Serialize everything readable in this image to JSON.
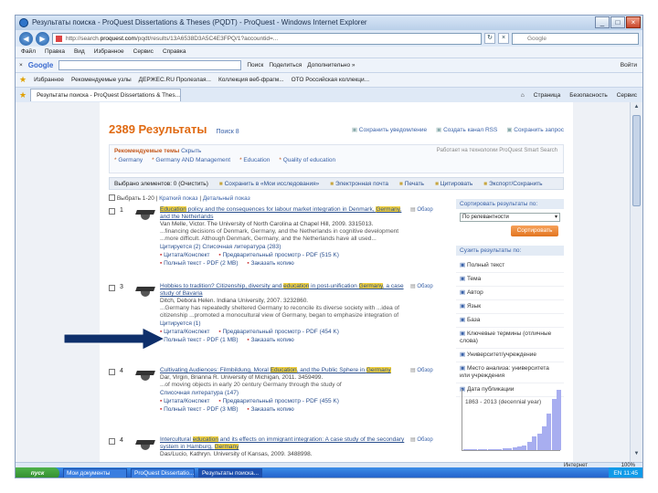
{
  "window": {
    "title": "Результаты поиска - ProQuest Dissertations & Theses (PQDT) - ProQuest - Windows Internet Explorer",
    "buttons": [
      "_",
      "□",
      "×"
    ]
  },
  "address_bar": {
    "url_prefix": "http://search.",
    "url_domain": "proquest.com",
    "url_rest": "/pqdt/results/13A6538D3A5C4E3FPQ/1?accountid=...",
    "search_placeholder": "Google"
  },
  "menu": [
    "Файл",
    "Правка",
    "Вид",
    "Избранное",
    "Сервис",
    "Справка"
  ],
  "google_bar": {
    "logo": "Google",
    "items": [
      "Поиск",
      "Поделиться",
      "Дополнительно »"
    ],
    "right": "Войти"
  },
  "favorites_bar": {
    "label": "Избранное",
    "items": [
      "Рекомендуемые узлы",
      "ДЕРЖЕС.RU Пролезлая...",
      "Коллекция веб-фрагм...",
      "ОТО Российская коллекци..."
    ]
  },
  "tab_row": {
    "tab": "Результаты поиска - ProQuest Dissertations & Thes...",
    "commands": [
      "Страница",
      "Безопасность",
      "Сервис"
    ]
  },
  "results": {
    "count_label": "2389 Результаты",
    "new_search": "Поиск 8",
    "actions": [
      "Сохранить уведомление",
      "Создать канал RSS",
      "Сохранить запрос"
    ],
    "recommended": {
      "title": "Рекомендуемые темы",
      "toggle": "Скрыть",
      "meta": "Работает на технологии ProQuest Smart Search",
      "items": [
        "Germany",
        "Germany AND Management",
        "Education",
        "Quality of education"
      ]
    },
    "toolbar": {
      "selected": "Выбрано элементов: 0 (Очистить)",
      "actions": [
        "Сохранить в «Мои исследования»",
        "Электронная почта",
        "Печать",
        "Цитировать",
        "Экспорт/Сохранить"
      ]
    },
    "view": {
      "select_label": "Выбрать 1-20",
      "brief": "Краткий показ",
      "detailed": "Детальный показ"
    },
    "items": [
      {
        "num": "1",
        "title_pre": "",
        "title_hl": "Education",
        "title_post": " policy and the consequences for labour market integration in Denmark, ",
        "title_hl2": "Germany",
        "title_post2": ", and the Netherlands",
        "author": "Van Melle, Victor. The University of North Carolina at Chapel Hill, 2009. 3315013.",
        "snippet": "...financing decisions of Denmark, Germany, and the Netherlands in cognitive development ...more difficult. Although Denmark, Germany, and the Netherlands have all used...",
        "cited": "Цитируется (2)    Списочная литература (283)",
        "links": [
          "Цитата/Конспект",
          "Предварительный просмотр - PDF (515 K)",
          "Полный текст - PDF (2 MB)",
          "Заказать копию"
        ],
        "cite": "Обзор"
      },
      {
        "num": "3",
        "title_pre": "Hobbies to tradition? Citizenship, diversity and ",
        "title_hl": "education",
        "title_post": " in post-unification ",
        "title_hl2": "Germany",
        "title_post2": ", a case study of Bavaria",
        "author": "Ditch, Debora Helen. Indiana University, 2007. 3232860.",
        "snippet": "...Germany has repeatedly sheltered Germany to reconcile its diverse society with ...idea of citizenship ...promoted a monocultural view of Germany, began to emphasize integration of",
        "cited": "Цитируется (1)",
        "links": [
          "Цитата/Конспект",
          "Предварительный просмотр - PDF (454 K)",
          "Полный текст - PDF (1 MB)",
          "Заказать копию"
        ],
        "cite": "Обзор"
      },
      {
        "num": "4",
        "title_pre": "Cultivating Audiences: Filmbildung, Moral ",
        "title_hl": "Education",
        "title_post": ", and the Public Sphere in ",
        "title_hl2": "Germany",
        "title_post2": "",
        "author": "Dar, Virgin, Brianna R. University of Michigan, 2011. 3459499.",
        "snippet": "...of moving objects in early 20 century Germany through the study of",
        "cited": "Списочная литература (147)",
        "links": [
          "Цитата/Конспект",
          "Предварительный просмотр - PDF (455 K)",
          "Полный текст - PDF (3 MB)",
          "Заказать копию"
        ],
        "cite": "Обзор"
      },
      {
        "num": "4",
        "title_pre": "Intercultural ",
        "title_hl": "education",
        "title_post": " and its effects on immigrant integration: A case study of the secondary system in Hamburg, ",
        "title_hl2": "Germany",
        "title_post2": "",
        "author": "Das/Lucio, Kathryn. University of Kansas, 2009. 3488998.",
        "snippet": "",
        "cited": "",
        "links": [],
        "cite": "Обзор"
      }
    ]
  },
  "sidebar": {
    "sort_header": "Сортировать результаты по:",
    "sort_value": "По релевантности",
    "sort_button": "Сортировать",
    "narrow_header": "Сузить результаты по:",
    "facets": [
      "Полный текст",
      "Тема",
      "Автор",
      "Язык",
      "База",
      "Ключевые термины (отличные слова)",
      "Университет/учреждение",
      "Место анализа: университета или учреждения",
      "Дата публикации"
    ],
    "date_range": "1863 - 2013 (decennial year)",
    "histogram": [
      1,
      1,
      0,
      1,
      1,
      2,
      2,
      2,
      3,
      3,
      4,
      6,
      8,
      14,
      22,
      28,
      40,
      60,
      85,
      100
    ]
  },
  "status": {
    "zone": "Интернет",
    "zoom": "100%"
  },
  "taskbar": {
    "start": "пуск",
    "tasks": [
      "Мои документы",
      "ProQuest Dissertatio...",
      "Результаты поиска..."
    ],
    "lang": "EN",
    "clock": "11:45"
  }
}
